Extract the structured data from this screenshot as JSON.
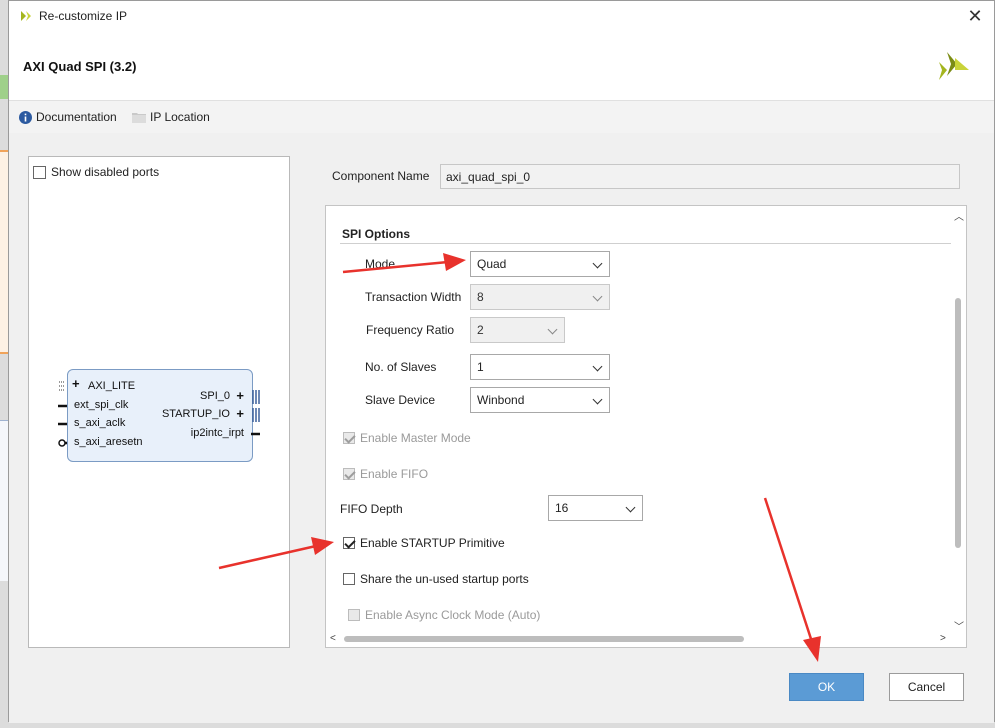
{
  "window": {
    "title": "Re-customize IP"
  },
  "header": {
    "ip_title": "AXI Quad SPI (3.2)"
  },
  "toolbar": {
    "documentation_label": "Documentation",
    "ip_location_label": "IP Location"
  },
  "left_panel": {
    "show_disabled_ports_label": "Show disabled ports",
    "show_disabled_ports_checked": false,
    "ip_block": {
      "left_ports": [
        "AXI_LITE",
        "ext_spi_clk",
        "s_axi_aclk",
        "s_axi_aresetn"
      ],
      "right_ports": [
        "SPI_0",
        "STARTUP_IO",
        "ip2intc_irpt"
      ]
    }
  },
  "component": {
    "label": "Component Name",
    "value": "axi_quad_spi_0"
  },
  "spi_options": {
    "section_title": "SPI Options",
    "mode_label": "Mode",
    "mode_value": "Quad",
    "transaction_width_label": "Transaction Width",
    "transaction_width_value": "8",
    "frequency_ratio_label": "Frequency Ratio",
    "frequency_ratio_value": "2",
    "no_of_slaves_label": "No. of Slaves",
    "no_of_slaves_value": "1",
    "slave_device_label": "Slave Device",
    "slave_device_value": "Winbond",
    "enable_master_mode_label": "Enable Master Mode",
    "enable_fifo_label": "Enable FIFO",
    "fifo_depth_label": "FIFO Depth",
    "fifo_depth_value": "16",
    "enable_startup_label": "Enable STARTUP Primitive",
    "share_startup_label": "Share the un-used startup ports",
    "enable_async_label": "Enable Async Clock Mode (Auto)"
  },
  "buttons": {
    "ok_label": "OK",
    "cancel_label": "Cancel"
  },
  "colors": {
    "accent": "#5b9bd5",
    "annotation_arrow": "#e8322c",
    "xilinx_logo": "#a4b51e"
  }
}
